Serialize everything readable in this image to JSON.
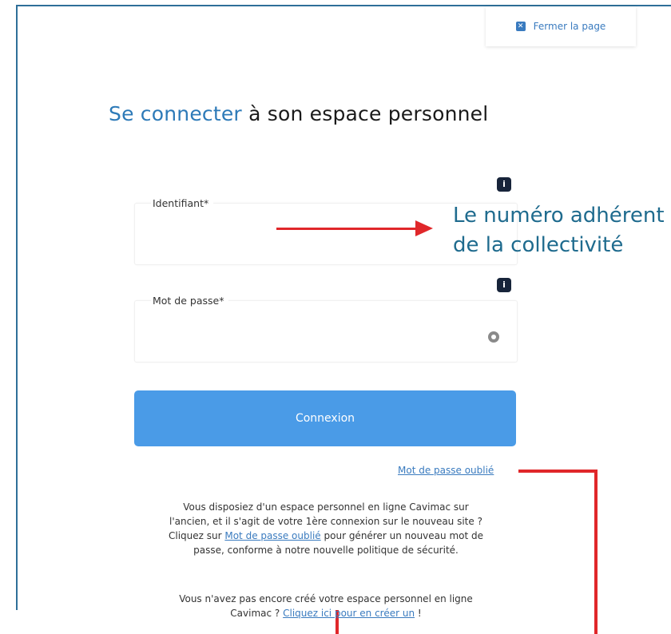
{
  "close": {
    "label": "Fermer la page"
  },
  "title": {
    "accent": "Se connecter",
    "rest": " à son espace personnel"
  },
  "fields": {
    "identifiant": {
      "label": "Identifiant*",
      "value": ""
    },
    "password": {
      "label": "Mot de passe*",
      "value": ""
    }
  },
  "info_button": {
    "glyph": "i"
  },
  "annotation": {
    "line1": "Le numéro adhérent",
    "line2": "de la collectivité"
  },
  "connect_button": {
    "label": "Connexion"
  },
  "forgot_link": {
    "label": "Mot de passe oublié"
  },
  "paragraph1": {
    "line1": "Vous disposiez d'un espace personnel en ligne Cavimac sur",
    "line2": "l'ancien, et il s'agit de votre 1ère connexion sur le nouveau site ?",
    "line3_pre": "Cliquez sur ",
    "line3_link": "Mot de passe oublié",
    "line3_post": " pour générer un nouveau mot de",
    "line4": "passe, conforme à notre nouvelle politique de sécurité."
  },
  "paragraph2": {
    "line1": "Vous n'avez pas encore créé votre espace personnel en ligne",
    "line2_pre": "Cavimac ? ",
    "line2_link": "Cliquez ici pour en créer un",
    "line2_post": " !"
  },
  "colors": {
    "accent": "#2d7ab8",
    "button": "#4a9be7",
    "annotation": "#1f6b8e",
    "callout": "#e0272a"
  }
}
